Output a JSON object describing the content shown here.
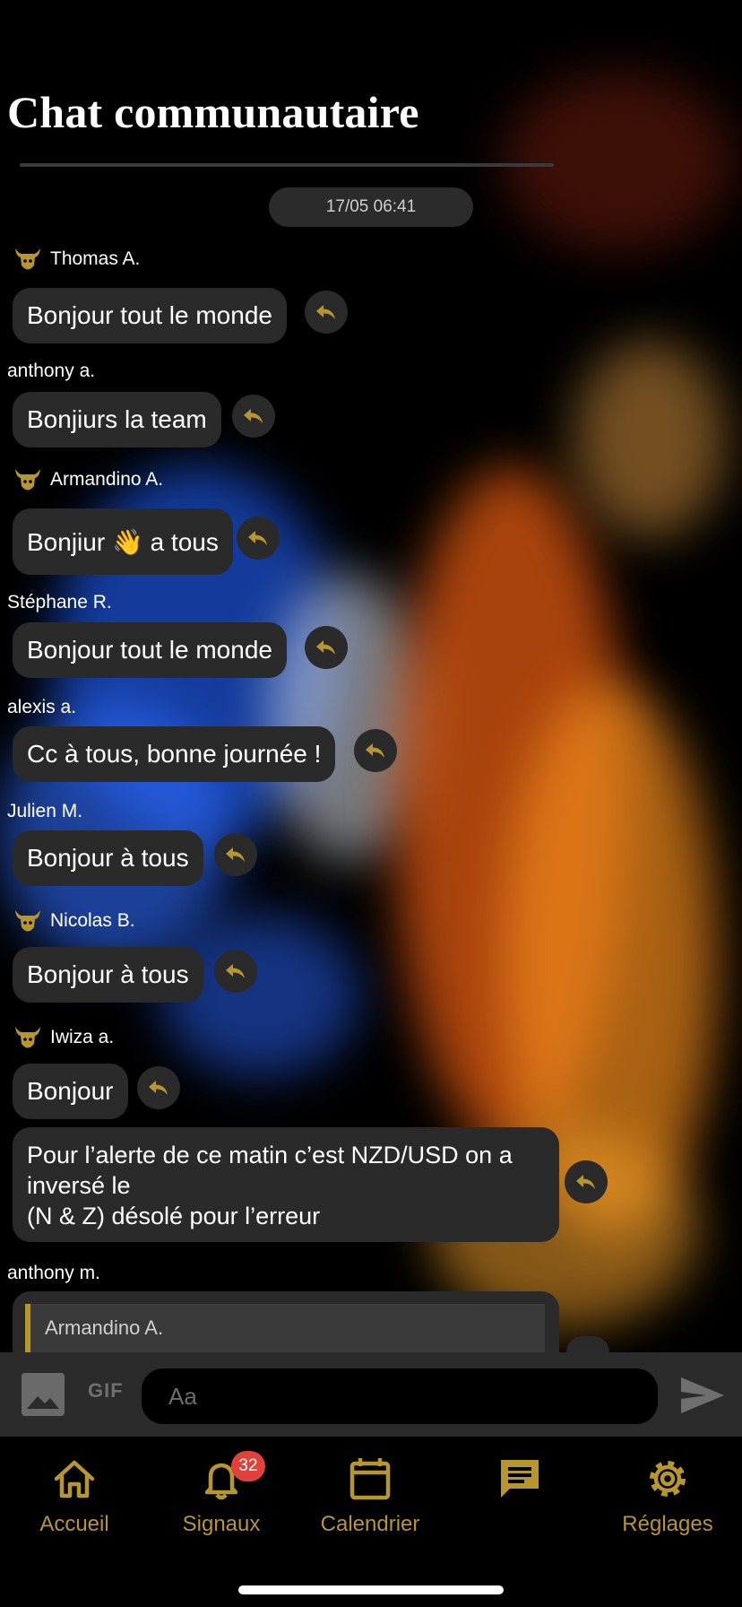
{
  "header": {
    "title": "Chat communautaire"
  },
  "date_separator": "17/05 06:41",
  "messages": [
    {
      "sender": "Thomas A.",
      "badge": true,
      "text": "Bonjour tout le monde"
    },
    {
      "sender": "anthony  a.",
      "badge": false,
      "text": "Bonjiurs la team"
    },
    {
      "sender": "Armandino A.",
      "badge": true,
      "text": "Bonjiur 👋 a tous"
    },
    {
      "sender": "Stéphane  R.",
      "badge": false,
      "text": "Bonjour tout le monde"
    },
    {
      "sender": "alexis a.",
      "badge": false,
      "text": "Cc à tous, bonne journée !"
    },
    {
      "sender": "Julien M.",
      "badge": false,
      "text": "Bonjour à tous"
    },
    {
      "sender": "Nicolas B.",
      "badge": true,
      "text": "Bonjour à tous"
    },
    {
      "sender": "Iwiza a.",
      "badge": true,
      "text": "Bonjour"
    },
    {
      "sender": "",
      "badge": false,
      "text": "Pour l’alerte de ce matin c’est NZD/USD on a inversé le\n(N & Z) désolé pour l’erreur"
    },
    {
      "sender": "anthony m.",
      "badge": false,
      "text": "",
      "quoted_sender": "Armandino A."
    }
  ],
  "composer": {
    "gif_label": "GIF",
    "placeholder": "Aa"
  },
  "tabs": [
    {
      "label": "Accueil",
      "icon": "home-icon"
    },
    {
      "label": "Signaux",
      "icon": "bell-icon",
      "badge": "32"
    },
    {
      "label": "Calendrier",
      "icon": "calendar-icon"
    },
    {
      "label": "",
      "icon": "chat-icon",
      "active": true
    },
    {
      "label": "Réglages",
      "icon": "gear-icon"
    }
  ],
  "colors": {
    "accent": "#b8962e",
    "bubble": "#2a2a2a",
    "badge": "#e0413b",
    "background": "#000000"
  }
}
